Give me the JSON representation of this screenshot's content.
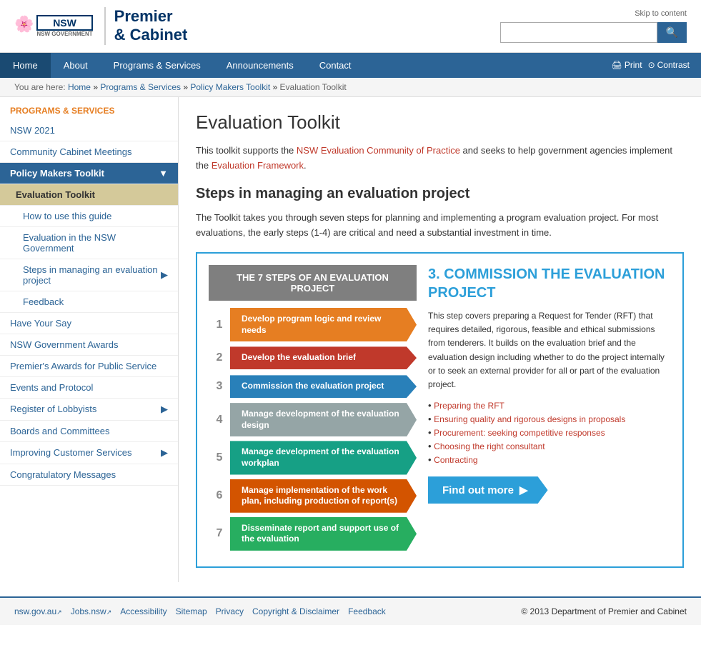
{
  "meta": {
    "skip_link": "Skip to content",
    "page_title": "Evaluation Toolkit"
  },
  "logo": {
    "govt_label": "NSW GOVERNMENT",
    "title_line1": "Premier",
    "title_line2": "& Cabinet"
  },
  "search": {
    "placeholder": "",
    "button_icon": "🔍"
  },
  "nav": {
    "items": [
      "Home",
      "About",
      "Programs & Services",
      "Announcements",
      "Contact"
    ],
    "print_label": "Print",
    "contrast_label": "Contrast"
  },
  "breadcrumb": {
    "items": [
      "Home",
      "Programs & Services",
      "Policy Makers Toolkit",
      "Evaluation Toolkit"
    ],
    "prefix": "You are here:"
  },
  "sidebar": {
    "section_title": "PROGRAMS & SERVICES",
    "links": [
      {
        "label": "NSW 2021",
        "level": 0
      },
      {
        "label": "Community Cabinet Meetings",
        "level": 0
      },
      {
        "label": "Policy Makers Toolkit",
        "level": 0,
        "active_parent": true,
        "has_arrow": true
      },
      {
        "label": "Evaluation Toolkit",
        "level": 1,
        "active_child": true
      },
      {
        "label": "How to use this guide",
        "level": 2
      },
      {
        "label": "Evaluation in the NSW Government",
        "level": 2
      },
      {
        "label": "Steps in managing an evaluation project",
        "level": 2,
        "has_arrow": true
      },
      {
        "label": "Feedback",
        "level": 2
      },
      {
        "label": "Have Your Say",
        "level": 0
      },
      {
        "label": "NSW Government Awards",
        "level": 0
      },
      {
        "label": "Premier's Awards for Public Service",
        "level": 0
      },
      {
        "label": "Events and Protocol",
        "level": 0
      },
      {
        "label": "Register of Lobbyists",
        "level": 0,
        "has_arrow": true
      },
      {
        "label": "Boards and Committees",
        "level": 0
      },
      {
        "label": "Improving Customer Services",
        "level": 0,
        "has_arrow": true
      },
      {
        "label": "Congratulatory Messages",
        "level": 0
      }
    ]
  },
  "main": {
    "page_title": "Evaluation Toolkit",
    "intro": "This toolkit supports the NSW Evaluation Community of Practice and seeks to help government agencies implement the Evaluation Framework.",
    "intro_link_text": "NSW Evaluation Community of Practice",
    "intro_link2_text": "Evaluation Framework",
    "steps_heading": "Steps in managing an evaluation project",
    "steps_desc": "The Toolkit takes you through seven steps for planning and implementing a program evaluation project. For most evaluations, the early steps (1-4) are critical and need a substantial investment in time.",
    "steps_header": "THE 7 STEPS OF AN EVALUATION PROJECT",
    "steps": [
      {
        "num": "1",
        "label": "Develop program logic and review needs",
        "color": "orange"
      },
      {
        "num": "2",
        "label": "Develop the evaluation brief",
        "color": "red"
      },
      {
        "num": "3",
        "label": "Commission the evaluation project",
        "color": "blue"
      },
      {
        "num": "4",
        "label": "Manage development of the evaluation design",
        "color": "gray"
      },
      {
        "num": "5",
        "label": "Manage development of the evaluation workplan",
        "color": "teal"
      },
      {
        "num": "6",
        "label": "Manage implementation of the work plan, including production of report(s)",
        "color": "pink"
      },
      {
        "num": "7",
        "label": "Disseminate report and support use of the evaluation",
        "color": "green"
      }
    ],
    "commission_title": "3. COMMISSION THE EVALUATION PROJECT",
    "commission_desc": "This step covers preparing a Request for Tender (RFT) that requires detailed, rigorous, feasible and ethical submissions from tenderers. It builds on the evaluation brief and the evaluation design including whether to do the project internally or to seek an external provider for all or part of the evaluation project.",
    "commission_links": [
      {
        "label": "Preparing the RFT"
      },
      {
        "label": "Ensuring quality and rigorous designs in proposals"
      },
      {
        "label": "Procurement: seeking competitive responses"
      },
      {
        "label": "Choosing the right consultant"
      },
      {
        "label": "Contracting"
      }
    ],
    "find_out_more": "Find out more"
  },
  "footer": {
    "links": [
      {
        "label": "nsw.gov.au",
        "external": true
      },
      {
        "label": "Jobs.nsw",
        "external": true
      },
      {
        "label": "Accessibility",
        "external": false
      },
      {
        "label": "Sitemap",
        "external": false
      },
      {
        "label": "Privacy",
        "external": false
      },
      {
        "label": "Copyright & Disclaimer",
        "external": false
      },
      {
        "label": "Feedback",
        "external": false
      }
    ],
    "copyright": "© 2013 Department of Premier and Cabinet"
  }
}
